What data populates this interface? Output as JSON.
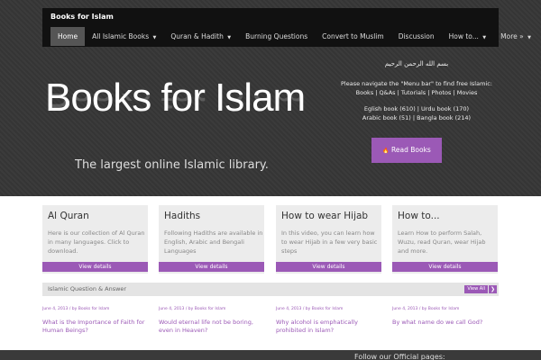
{
  "brand": "Books for Islam",
  "menu": [
    {
      "label": "Home",
      "caret": ""
    },
    {
      "label": "All Islamic Books",
      "caret": "▼"
    },
    {
      "label": "Quran & Hadith",
      "caret": "▼"
    },
    {
      "label": "Burning Questions",
      "caret": ""
    },
    {
      "label": "Convert to Muslim",
      "caret": ""
    },
    {
      "label": "Discussion",
      "caret": ""
    },
    {
      "label": "How to...",
      "caret": "▼"
    },
    {
      "label": "More »",
      "caret": "▼"
    }
  ],
  "hero": {
    "title": "Books for Islam",
    "tagline": "The largest online Islamic library.",
    "arabic": "بسم الله الرحمن الرحيم",
    "nav_text": "Please navigate the \"Menu bar\" to find free Islamic:",
    "categories": "Books | Q&As | Tutorials | Photos | Movies",
    "counts_line1": "Eglish book (610) | Urdu book (170)",
    "counts_line2": "Arabic book (51) | Bangla book (214)",
    "button_icon": "🔥",
    "button_label": "Read Books"
  },
  "cards": [
    {
      "title": "Al Quran",
      "text": "Here is our collection of Al Quran in many languages. Click to download.",
      "button": "View details"
    },
    {
      "title": "Hadiths",
      "text": "Following Hadiths are available in English, Arabic and Bengali Languages",
      "button": "View details"
    },
    {
      "title": "How to wear Hijab",
      "text": "In this video, you can learn how to wear Hijab in a few very basic steps",
      "button": "View details"
    },
    {
      "title": "How to...",
      "text": "Learn How to perform Salah, Wuzu, read Quran, wear Hijab and more.",
      "button": "View details"
    }
  ],
  "qa": {
    "title": "Islamic Question & Answer",
    "view_all": "View All",
    "arrow": "❯",
    "items": [
      {
        "meta": "June 4, 2013 / by Books for Islam",
        "title": "What is the Importance of Faith for Human Beings?"
      },
      {
        "meta": "June 4, 2013 / by Books for Islam",
        "title": "Would eternal life not be boring, even in Heaven?"
      },
      {
        "meta": "June 4, 2013 / by Books for Islam",
        "title": "Why alcohol is emphatically prohibited in Islam?"
      },
      {
        "meta": "June 4, 2013 / by Books for Islam",
        "title": "By what name do we call God?"
      }
    ]
  },
  "footer": {
    "text": "Follow our Official pages:"
  }
}
